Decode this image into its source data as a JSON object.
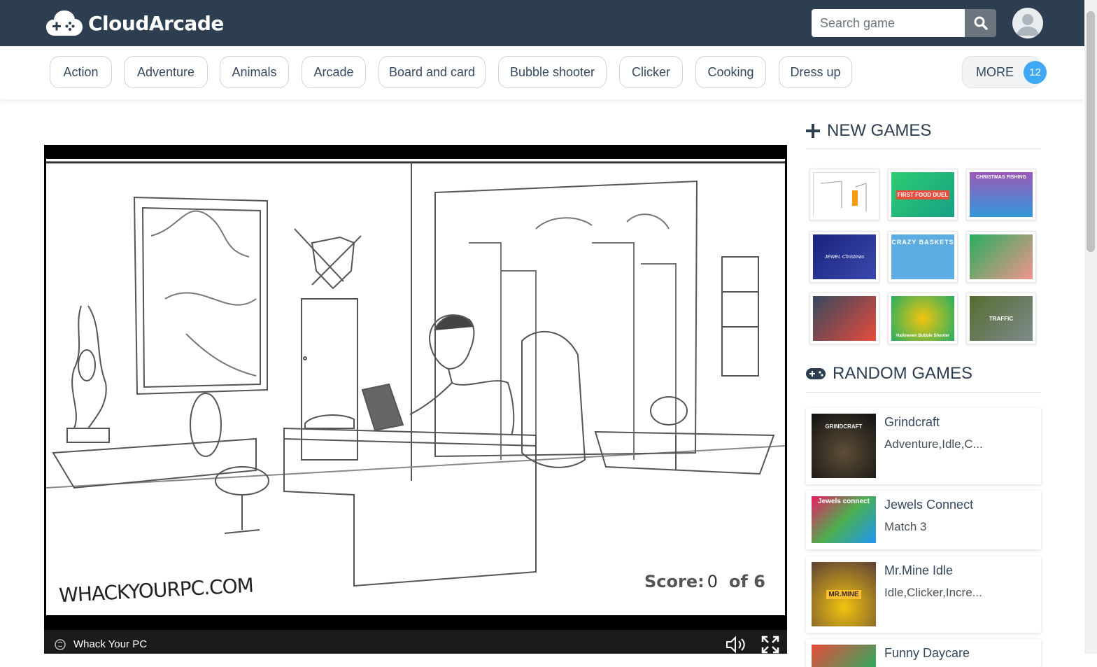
{
  "header": {
    "logo_text": "CloudArcade",
    "search_placeholder": "Search game"
  },
  "categories": [
    {
      "label": "Action"
    },
    {
      "label": "Adventure"
    },
    {
      "label": "Animals"
    },
    {
      "label": "Arcade"
    },
    {
      "label": "Board and card"
    },
    {
      "label": "Bubble shooter"
    },
    {
      "label": "Clicker"
    },
    {
      "label": "Cooking"
    },
    {
      "label": "Dress up"
    }
  ],
  "more": {
    "label": "MORE",
    "count": "12"
  },
  "game": {
    "title": "Whack Your PC",
    "watermark": "WHACKYOURPC.COM",
    "score_label": "Score:",
    "score_value": "0",
    "score_of": "of",
    "score_total": "6"
  },
  "new_games": {
    "title": "NEW GAMES",
    "thumb_texts": [
      "",
      "FIRST FOOD DUEL",
      "CHRISTMAS FISHING",
      "JEWEL Christmas",
      "CRAZY BASKETS",
      "",
      "",
      "Halloween Bubble Shooter",
      "TRAFFIC"
    ]
  },
  "random_games": {
    "title": "RANDOM GAMES",
    "items": [
      {
        "name": "Grindcraft",
        "tags": "Adventure,Idle,C...",
        "logo": "GRINDCRAFT"
      },
      {
        "name": "Jewels Connect",
        "tags": "Match 3",
        "logo": "Jewels connect"
      },
      {
        "name": "Mr.Mine Idle",
        "tags": "Idle,Clicker,Incre...",
        "logo": "MR.MINE"
      },
      {
        "name": "Funny Daycare",
        "tags": "",
        "logo": ""
      }
    ]
  },
  "colors": {
    "header_bg": "#2c3e50",
    "badge": "#3fa9f5",
    "text": "#34495e"
  }
}
